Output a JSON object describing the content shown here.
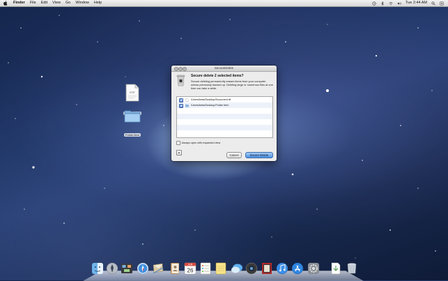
{
  "menubar": {
    "app_name": "Finder",
    "items": [
      "File",
      "Edit",
      "View",
      "Go",
      "Window",
      "Help"
    ],
    "clock": "Tue 2:44 AM"
  },
  "desktop": {
    "icons": [
      {
        "label": "Document.rtf",
        "badge": "RTF"
      },
      {
        "label": "Folder item"
      }
    ]
  },
  "dialog": {
    "title": "SecureDelete",
    "heading": "Secure delete 2 selected items?",
    "info": "Secure deleting permanently erases items from your computer unless previously backed up. Deleting large or numerous files at one time can take a while.",
    "files": [
      {
        "path": "/Users/beta/Desktop/Document.rtf",
        "checked": true,
        "kind": "file"
      },
      {
        "path": "/Users/beta/Desktop/Folder item",
        "checked": true,
        "kind": "folder"
      }
    ],
    "expanded_checkbox_label": "Always open with expanded view",
    "info_button": "▲",
    "cancel_label": "Cancel",
    "confirm_label": "Secure Delete"
  },
  "dock": {
    "items": [
      "finder-icon",
      "launchpad-icon",
      "mission-control-icon",
      "safari-icon",
      "mail-icon",
      "contacts-icon",
      "calendar-icon",
      "reminders-icon",
      "notes-icon",
      "messages-icon",
      "facetime-icon",
      "photo-booth-icon",
      "itunes-icon",
      "app-store-icon",
      "system-preferences-icon",
      "downloads-stack-icon",
      "trash-icon"
    ],
    "calendar_day": "26",
    "calendar_month": "JUN"
  },
  "colors": {
    "accent": "#4b8fe0",
    "menubar": "#e6e6e6",
    "desktop": "#1c3363"
  }
}
